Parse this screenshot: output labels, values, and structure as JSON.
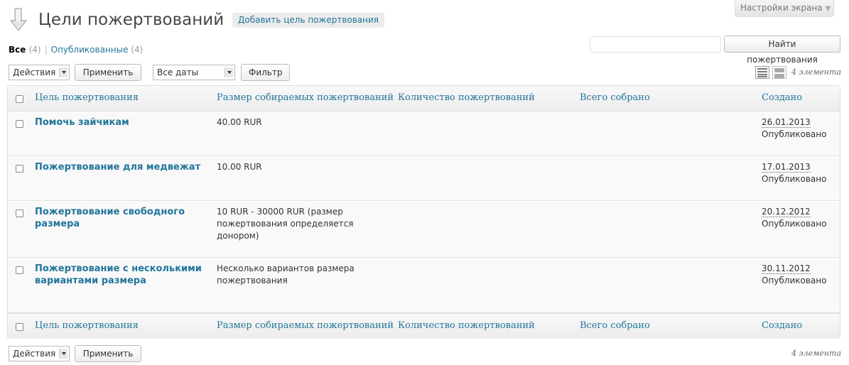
{
  "header": {
    "title": "Цели пожертвований",
    "add_new": "Добавить цель пожертвования",
    "screen_options": "Настройки экрана"
  },
  "subsubsub": {
    "all_label": "Все",
    "all_count": "(4)",
    "published_label": "Опубликованные",
    "published_count": "(4)",
    "separator": "|"
  },
  "search": {
    "value": "",
    "button": "Найти пожертвования"
  },
  "tablenav_top": {
    "bulk_actions": "Действия",
    "apply": "Применить",
    "dates": "Все даты",
    "filter": "Фильтр",
    "items_count": "4 элемента"
  },
  "tablenav_bottom": {
    "bulk_actions": "Действия",
    "apply": "Применить",
    "items_count": "4 элемента"
  },
  "columns": {
    "title": "Цель пожертвования",
    "amount": "Размер собираемых пожертвований",
    "count": "Количество пожертвований",
    "total": "Всего собрано",
    "date": "Создано"
  },
  "rows": [
    {
      "title": "Помочь зайчикам",
      "amount": "40.00 RUR",
      "count": "",
      "total": "",
      "date": "26.01.2013",
      "status": "Опубликовано"
    },
    {
      "title": "Пожертвование для медвежат",
      "amount": "10.00 RUR",
      "count": "",
      "total": "",
      "date": "17.01.2013",
      "status": "Опубликовано"
    },
    {
      "title": "Пожертвование свободного размера",
      "amount": "10 RUR - 30000 RUR (размер пожертвования определяется донором)",
      "count": "",
      "total": "",
      "date": "20.12.2012",
      "status": "Опубликовано"
    },
    {
      "title": "Пожертвование с несколькими вариантами размера",
      "amount": "Несколько вариантов размера пожертвования",
      "count": "",
      "total": "",
      "date": "30.11.2012",
      "status": "Опубликовано"
    }
  ],
  "colors": {
    "link": "#21759b",
    "header_bg": "#ececec",
    "table_bg": "#f9f9f9",
    "border": "#dfdfdf"
  }
}
